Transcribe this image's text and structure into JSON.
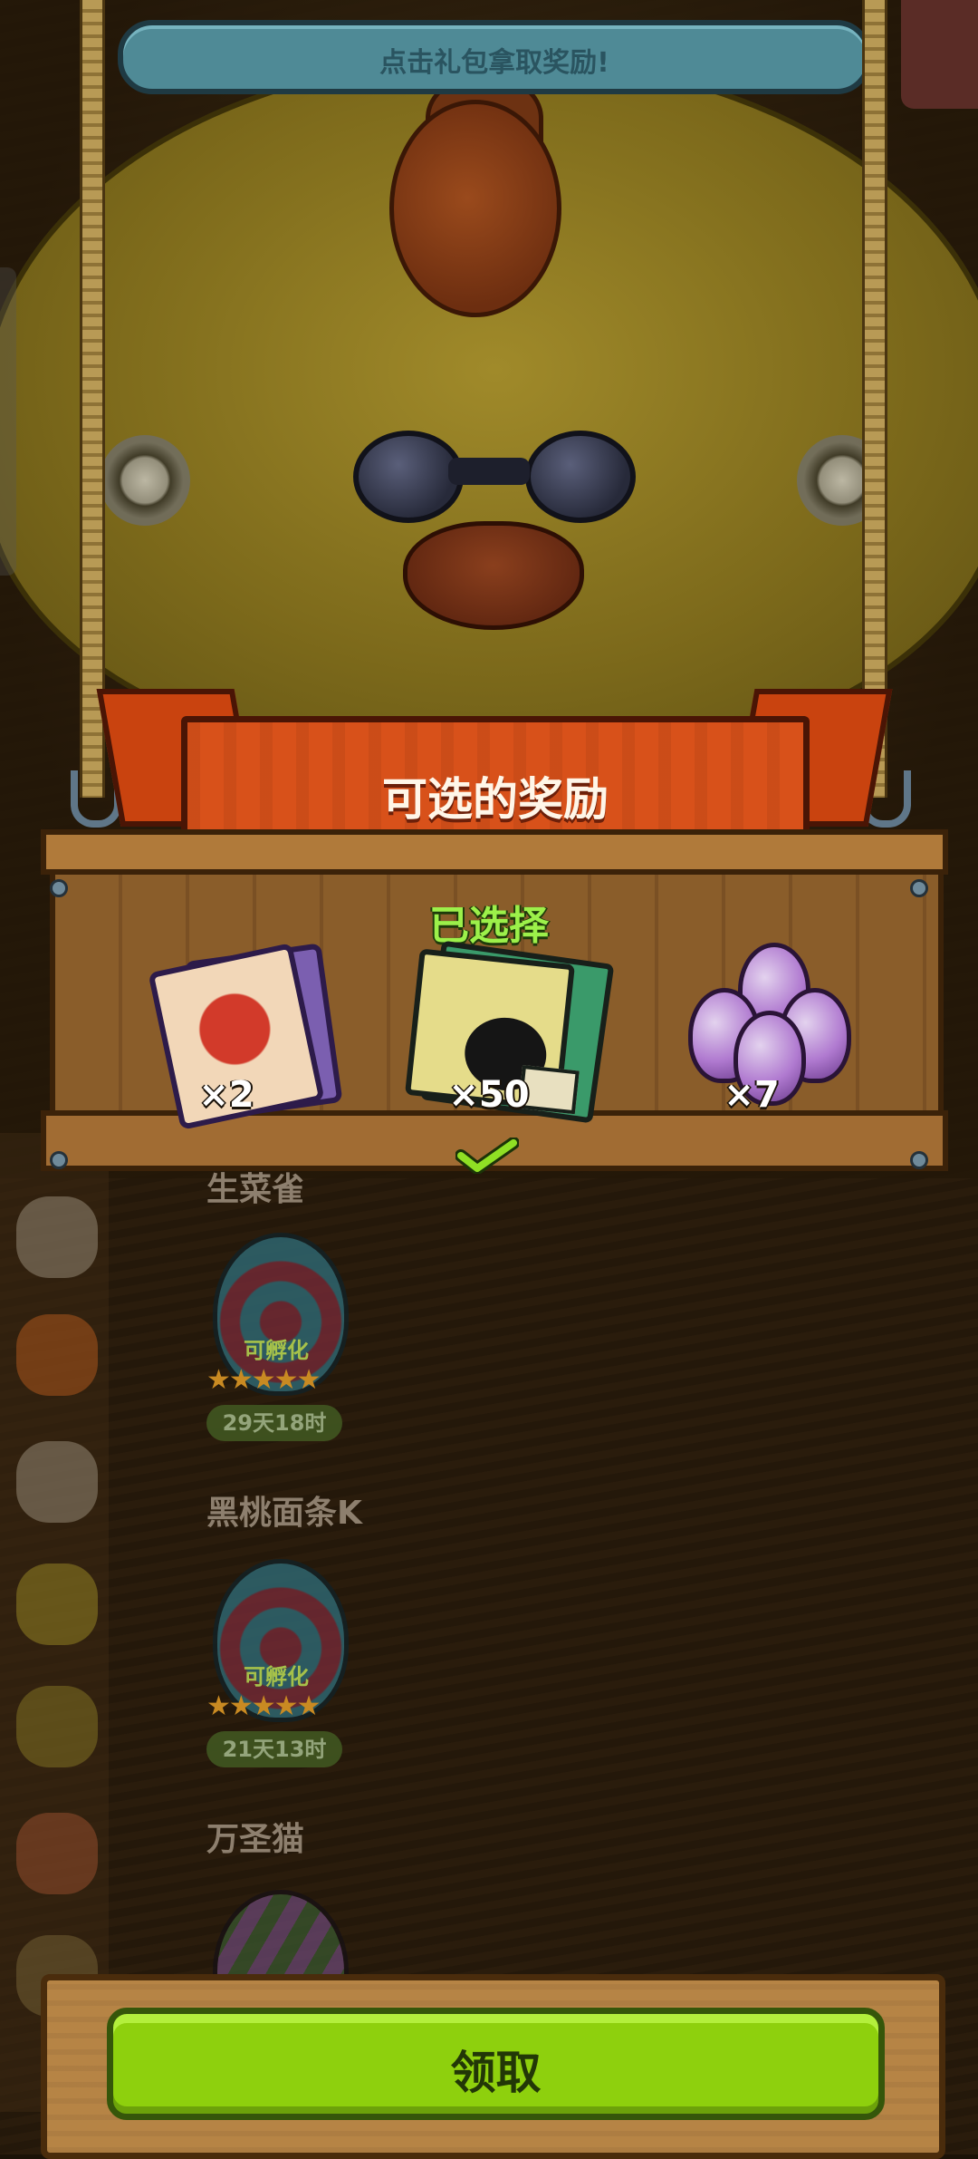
{
  "top_hint": "点击礼包拿取奖励!",
  "title": "可选的奖励",
  "selected_label": "已选择",
  "rewards": [
    {
      "icon": "scroll-icon",
      "quantity": "×2",
      "selected": false
    },
    {
      "icon": "book-icon",
      "quantity": "×50",
      "selected": true
    },
    {
      "icon": "crystal-cluster-icon",
      "quantity": "×7",
      "selected": false
    }
  ],
  "background_list": {
    "first_title_partial": "生菜雀",
    "items": [
      {
        "status": "可孵化",
        "stars": "★★★★★",
        "timer": "29天18时"
      },
      {
        "title": "黑桃面条K",
        "status": "可孵化",
        "stars": "★★★★★",
        "timer": "21天13时"
      },
      {
        "title": "万圣猫"
      }
    ]
  },
  "claim_label": "领取",
  "colors": {
    "accent_green": "#8ed00d",
    "ribbon": "#d8511a",
    "selected_text": "#9cf04a"
  }
}
